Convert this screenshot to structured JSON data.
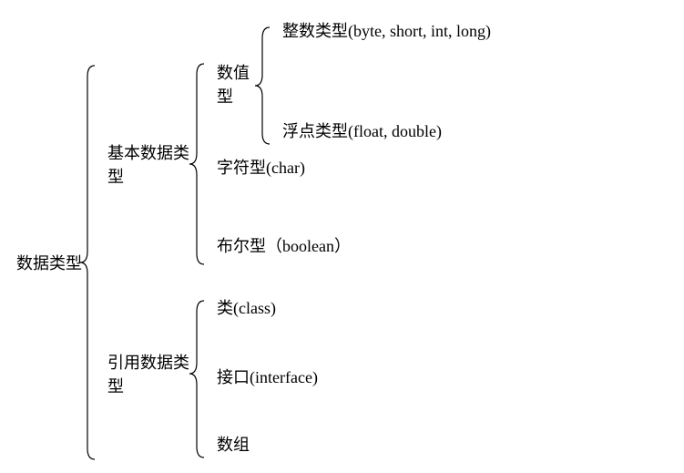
{
  "root": "数据类型",
  "primitive": {
    "label_l1": "基本数据类",
    "label_l2": "型",
    "numeric": {
      "label_l1": "数值",
      "label_l2": "型",
      "integer": "整数类型(byte, short, int, long)",
      "float": "浮点类型(float, double)"
    },
    "char": "字符型(char)",
    "boolean": "布尔型（boolean）"
  },
  "reference": {
    "label_l1": "引用数据类",
    "label_l2": "型",
    "class": "类(class)",
    "interface": "接口(interface)",
    "array": "数组"
  }
}
